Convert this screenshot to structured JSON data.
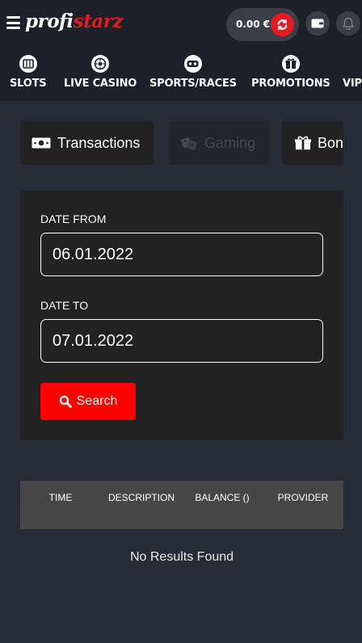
{
  "header": {
    "logo_part1": "profi",
    "logo_part2": "starz",
    "balance": "0.00 €",
    "accent_color": "#e51b23"
  },
  "nav": {
    "items": [
      {
        "label": "SLOTS",
        "icon": "slot-machine-icon"
      },
      {
        "label": "LIVE CASINO",
        "icon": "roulette-icon"
      },
      {
        "label": "SPORTS/RACES",
        "icon": "vr-headset-icon"
      },
      {
        "label": "PROMOTIONS",
        "icon": "gift-icon"
      },
      {
        "label": "VIP",
        "icon": "vip-icon"
      }
    ]
  },
  "tabs": [
    {
      "label": "Transactions",
      "icon": "cash-icon",
      "state": "active"
    },
    {
      "label": "Gaming",
      "icon": "dice-icon",
      "state": "disabled"
    },
    {
      "label": "Bon",
      "icon": "gift-icon",
      "state": "active"
    }
  ],
  "filter": {
    "date_from_label": "DATE FROM",
    "date_from_value": "06.01.2022",
    "date_to_label": "DATE TO",
    "date_to_value": "07.01.2022",
    "search_label": "Search"
  },
  "table": {
    "columns": [
      "TIME",
      "DESCRIPTION",
      "BALANCE ()",
      "PROVIDER"
    ],
    "empty_message": "No Results Found"
  }
}
